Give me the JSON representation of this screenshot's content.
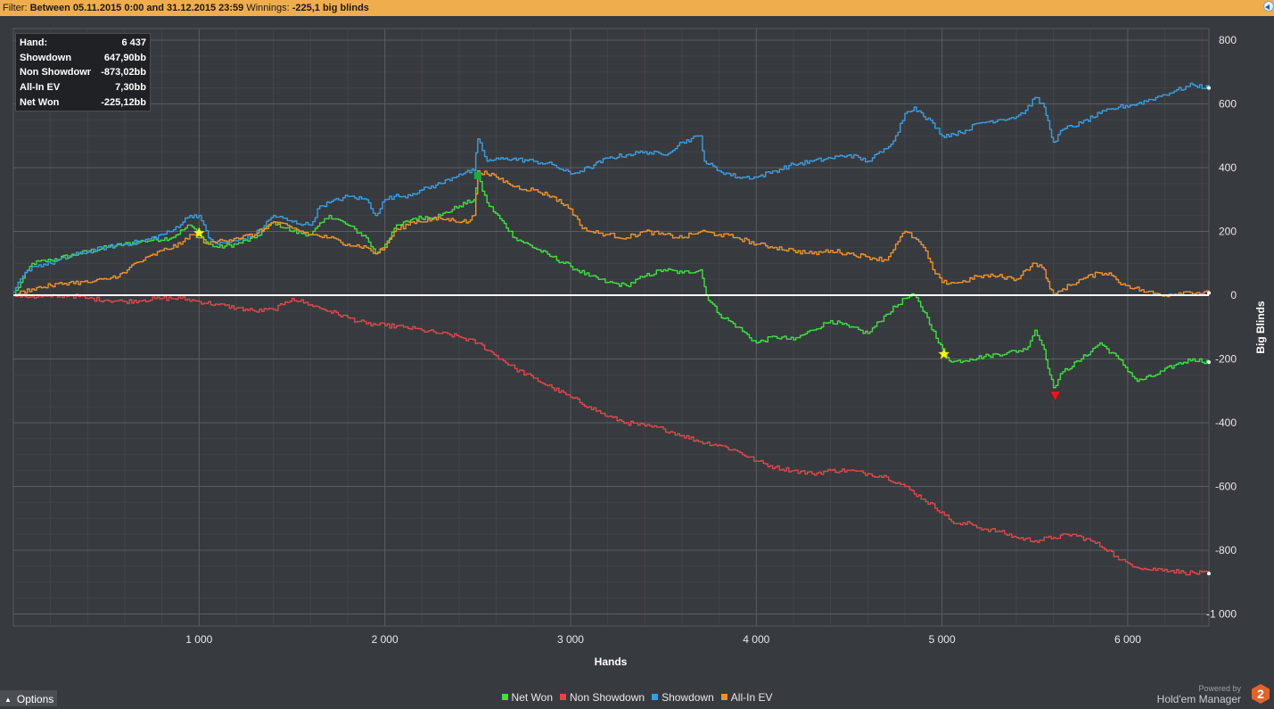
{
  "filter": {
    "prefix": "Filter:",
    "range": "Between 05.11.2015 0:00 and 31.12.2015 23:59",
    "winnings_label": "Winnings:",
    "winnings_value": "-225,1 big blinds"
  },
  "stats": [
    {
      "label": "Hand:",
      "value": "6 437"
    },
    {
      "label": "Showdown",
      "value": "647,90bb"
    },
    {
      "label": "Non Showdown",
      "value": "-873,02bb"
    },
    {
      "label": "All-In EV",
      "value": "7,30bb"
    },
    {
      "label": "Net Won",
      "value": "-225,12bb"
    }
  ],
  "options": {
    "label": "Options"
  },
  "powered": {
    "line1": "Powered by",
    "line2": "Hold'em Manager",
    "logo": "2"
  },
  "chart_data": {
    "type": "line",
    "title": "",
    "xlabel": "Hands",
    "ylabel": "Big Blinds",
    "xlim": [
      0,
      6437
    ],
    "ylim": [
      -1000,
      800
    ],
    "x_ticks": [
      1000,
      2000,
      3000,
      4000,
      5000,
      6000
    ],
    "x_tick_labels": [
      "1 000",
      "2 000",
      "3 000",
      "4 000",
      "5 000",
      "6 000"
    ],
    "y_ticks": [
      800,
      600,
      400,
      200,
      0,
      -200,
      -400,
      -600,
      -800,
      -1000
    ],
    "y_tick_labels": [
      "800",
      "600",
      "400",
      "200",
      "0",
      "-200",
      "-400",
      "-600",
      "-800",
      "-1 000"
    ],
    "grid": true,
    "zero_line_color": "#ffffff",
    "legend_position": "bottom-center",
    "series": [
      {
        "name": "Net Won",
        "color": "#3fe03f",
        "points": [
          [
            0,
            0
          ],
          [
            40,
            40
          ],
          [
            100,
            100
          ],
          [
            200,
            110
          ],
          [
            350,
            130
          ],
          [
            500,
            150
          ],
          [
            700,
            170
          ],
          [
            850,
            180
          ],
          [
            950,
            220
          ],
          [
            1000,
            190
          ],
          [
            1050,
            160
          ],
          [
            1100,
            150
          ],
          [
            1200,
            160
          ],
          [
            1300,
            180
          ],
          [
            1400,
            230
          ],
          [
            1500,
            200
          ],
          [
            1600,
            190
          ],
          [
            1700,
            250
          ],
          [
            1800,
            220
          ],
          [
            1900,
            180
          ],
          [
            1950,
            130
          ],
          [
            2000,
            160
          ],
          [
            2050,
            210
          ],
          [
            2150,
            240
          ],
          [
            2300,
            250
          ],
          [
            2400,
            280
          ],
          [
            2480,
            300
          ],
          [
            2500,
            370
          ],
          [
            2550,
            290
          ],
          [
            2700,
            180
          ],
          [
            2900,
            120
          ],
          [
            3000,
            90
          ],
          [
            3100,
            60
          ],
          [
            3200,
            40
          ],
          [
            3300,
            30
          ],
          [
            3400,
            60
          ],
          [
            3500,
            80
          ],
          [
            3600,
            70
          ],
          [
            3700,
            80
          ],
          [
            3730,
            0
          ],
          [
            3800,
            -60
          ],
          [
            3900,
            -100
          ],
          [
            4000,
            -150
          ],
          [
            4100,
            -130
          ],
          [
            4200,
            -140
          ],
          [
            4300,
            -110
          ],
          [
            4400,
            -80
          ],
          [
            4500,
            -100
          ],
          [
            4600,
            -120
          ],
          [
            4700,
            -60
          ],
          [
            4800,
            -10
          ],
          [
            4850,
            0
          ],
          [
            4920,
            -70
          ],
          [
            4980,
            -150
          ],
          [
            5050,
            -210
          ],
          [
            5150,
            -200
          ],
          [
            5250,
            -190
          ],
          [
            5350,
            -180
          ],
          [
            5450,
            -170
          ],
          [
            5500,
            -110
          ],
          [
            5550,
            -170
          ],
          [
            5580,
            -250
          ],
          [
            5600,
            -290
          ],
          [
            5650,
            -240
          ],
          [
            5750,
            -200
          ],
          [
            5850,
            -150
          ],
          [
            5950,
            -200
          ],
          [
            6050,
            -270
          ],
          [
            6150,
            -250
          ],
          [
            6250,
            -220
          ],
          [
            6350,
            -200
          ],
          [
            6437,
            -210
          ]
        ]
      },
      {
        "name": "Non Showdown",
        "color": "#e04848",
        "points": [
          [
            0,
            0
          ],
          [
            100,
            -5
          ],
          [
            200,
            -5
          ],
          [
            300,
            0
          ],
          [
            400,
            -10
          ],
          [
            500,
            -15
          ],
          [
            600,
            -20
          ],
          [
            700,
            -15
          ],
          [
            800,
            -10
          ],
          [
            900,
            -10
          ],
          [
            1000,
            -20
          ],
          [
            1100,
            -30
          ],
          [
            1200,
            -40
          ],
          [
            1300,
            -50
          ],
          [
            1400,
            -45
          ],
          [
            1450,
            -30
          ],
          [
            1500,
            -10
          ],
          [
            1600,
            -30
          ],
          [
            1700,
            -50
          ],
          [
            1800,
            -70
          ],
          [
            1900,
            -90
          ],
          [
            2000,
            -95
          ],
          [
            2100,
            -100
          ],
          [
            2200,
            -110
          ],
          [
            2300,
            -120
          ],
          [
            2400,
            -130
          ],
          [
            2500,
            -150
          ],
          [
            2600,
            -190
          ],
          [
            2700,
            -230
          ],
          [
            2800,
            -260
          ],
          [
            2900,
            -290
          ],
          [
            3000,
            -320
          ],
          [
            3100,
            -350
          ],
          [
            3200,
            -380
          ],
          [
            3300,
            -400
          ],
          [
            3400,
            -410
          ],
          [
            3500,
            -420
          ],
          [
            3600,
            -440
          ],
          [
            3700,
            -460
          ],
          [
            3800,
            -470
          ],
          [
            3900,
            -490
          ],
          [
            4000,
            -520
          ],
          [
            4100,
            -540
          ],
          [
            4200,
            -550
          ],
          [
            4300,
            -560
          ],
          [
            4400,
            -550
          ],
          [
            4500,
            -550
          ],
          [
            4600,
            -560
          ],
          [
            4700,
            -570
          ],
          [
            4800,
            -600
          ],
          [
            4900,
            -640
          ],
          [
            5000,
            -680
          ],
          [
            5050,
            -710
          ],
          [
            5100,
            -720
          ],
          [
            5150,
            -715
          ],
          [
            5200,
            -730
          ],
          [
            5300,
            -740
          ],
          [
            5400,
            -760
          ],
          [
            5500,
            -770
          ],
          [
            5600,
            -760
          ],
          [
            5700,
            -750
          ],
          [
            5800,
            -770
          ],
          [
            5900,
            -800
          ],
          [
            5950,
            -830
          ],
          [
            6000,
            -840
          ],
          [
            6100,
            -860
          ],
          [
            6200,
            -860
          ],
          [
            6300,
            -870
          ],
          [
            6437,
            -873
          ]
        ]
      },
      {
        "name": "Showdown",
        "color": "#3a9ee0",
        "points": [
          [
            0,
            10
          ],
          [
            50,
            60
          ],
          [
            100,
            90
          ],
          [
            200,
            100
          ],
          [
            350,
            130
          ],
          [
            500,
            150
          ],
          [
            700,
            170
          ],
          [
            850,
            200
          ],
          [
            950,
            250
          ],
          [
            1000,
            250
          ],
          [
            1050,
            180
          ],
          [
            1100,
            160
          ],
          [
            1200,
            170
          ],
          [
            1300,
            190
          ],
          [
            1400,
            250
          ],
          [
            1500,
            230
          ],
          [
            1600,
            220
          ],
          [
            1650,
            280
          ],
          [
            1700,
            290
          ],
          [
            1800,
            310
          ],
          [
            1900,
            300
          ],
          [
            1950,
            250
          ],
          [
            2000,
            300
          ],
          [
            2050,
            310
          ],
          [
            2100,
            310
          ],
          [
            2200,
            330
          ],
          [
            2300,
            350
          ],
          [
            2400,
            380
          ],
          [
            2480,
            390
          ],
          [
            2500,
            490
          ],
          [
            2550,
            420
          ],
          [
            2650,
            430
          ],
          [
            2800,
            420
          ],
          [
            2900,
            410
          ],
          [
            3000,
            380
          ],
          [
            3100,
            400
          ],
          [
            3200,
            430
          ],
          [
            3300,
            440
          ],
          [
            3400,
            450
          ],
          [
            3500,
            440
          ],
          [
            3600,
            480
          ],
          [
            3700,
            500
          ],
          [
            3720,
            420
          ],
          [
            3800,
            390
          ],
          [
            3900,
            370
          ],
          [
            4000,
            370
          ],
          [
            4100,
            390
          ],
          [
            4200,
            410
          ],
          [
            4300,
            420
          ],
          [
            4400,
            430
          ],
          [
            4500,
            440
          ],
          [
            4600,
            420
          ],
          [
            4700,
            460
          ],
          [
            4750,
            500
          ],
          [
            4800,
            570
          ],
          [
            4850,
            590
          ],
          [
            4900,
            560
          ],
          [
            4950,
            540
          ],
          [
            5000,
            500
          ],
          [
            5100,
            510
          ],
          [
            5200,
            540
          ],
          [
            5300,
            550
          ],
          [
            5400,
            560
          ],
          [
            5450,
            580
          ],
          [
            5500,
            620
          ],
          [
            5550,
            590
          ],
          [
            5580,
            520
          ],
          [
            5600,
            480
          ],
          [
            5650,
            520
          ],
          [
            5750,
            540
          ],
          [
            5850,
            570
          ],
          [
            5950,
            590
          ],
          [
            6050,
            600
          ],
          [
            6150,
            620
          ],
          [
            6250,
            640
          ],
          [
            6350,
            660
          ],
          [
            6437,
            650
          ]
        ]
      },
      {
        "name": "All-In EV",
        "color": "#f0922b",
        "points": [
          [
            0,
            0
          ],
          [
            100,
            20
          ],
          [
            200,
            30
          ],
          [
            300,
            40
          ],
          [
            400,
            40
          ],
          [
            500,
            50
          ],
          [
            600,
            70
          ],
          [
            650,
            100
          ],
          [
            700,
            110
          ],
          [
            800,
            140
          ],
          [
            900,
            160
          ],
          [
            950,
            190
          ],
          [
            1000,
            180
          ],
          [
            1050,
            160
          ],
          [
            1100,
            170
          ],
          [
            1200,
            180
          ],
          [
            1300,
            190
          ],
          [
            1400,
            230
          ],
          [
            1500,
            210
          ],
          [
            1600,
            190
          ],
          [
            1700,
            180
          ],
          [
            1800,
            160
          ],
          [
            1900,
            150
          ],
          [
            1950,
            130
          ],
          [
            2000,
            150
          ],
          [
            2050,
            200
          ],
          [
            2150,
            230
          ],
          [
            2300,
            240
          ],
          [
            2450,
            230
          ],
          [
            2480,
            250
          ],
          [
            2500,
            390
          ],
          [
            2550,
            380
          ],
          [
            2600,
            370
          ],
          [
            2700,
            340
          ],
          [
            2800,
            330
          ],
          [
            2900,
            310
          ],
          [
            3000,
            270
          ],
          [
            3050,
            220
          ],
          [
            3100,
            200
          ],
          [
            3200,
            190
          ],
          [
            3300,
            180
          ],
          [
            3400,
            200
          ],
          [
            3500,
            190
          ],
          [
            3600,
            180
          ],
          [
            3700,
            200
          ],
          [
            3800,
            190
          ],
          [
            3900,
            180
          ],
          [
            4000,
            160
          ],
          [
            4100,
            150
          ],
          [
            4200,
            140
          ],
          [
            4300,
            130
          ],
          [
            4400,
            140
          ],
          [
            4500,
            130
          ],
          [
            4600,
            120
          ],
          [
            4700,
            110
          ],
          [
            4750,
            160
          ],
          [
            4800,
            200
          ],
          [
            4850,
            180
          ],
          [
            4900,
            150
          ],
          [
            4950,
            80
          ],
          [
            5000,
            40
          ],
          [
            5100,
            40
          ],
          [
            5200,
            60
          ],
          [
            5300,
            60
          ],
          [
            5400,
            50
          ],
          [
            5450,
            80
          ],
          [
            5500,
            100
          ],
          [
            5550,
            80
          ],
          [
            5580,
            20
          ],
          [
            5600,
            0
          ],
          [
            5650,
            20
          ],
          [
            5750,
            50
          ],
          [
            5850,
            70
          ],
          [
            5900,
            70
          ],
          [
            5950,
            40
          ],
          [
            6000,
            30
          ],
          [
            6100,
            10
          ],
          [
            6200,
            0
          ],
          [
            6300,
            10
          ],
          [
            6437,
            7
          ]
        ]
      }
    ],
    "markers": [
      {
        "type": "star",
        "x": 1000,
        "y": 195,
        "color": "#f5f520"
      },
      {
        "type": "star",
        "x": 5010,
        "y": -185,
        "color": "#f5f520"
      },
      {
        "type": "square",
        "x": 2500,
        "y": 375,
        "color": "#1faa3a"
      },
      {
        "type": "triangle-down",
        "x": 5610,
        "y": -315,
        "color": "#e01a1a"
      }
    ]
  }
}
